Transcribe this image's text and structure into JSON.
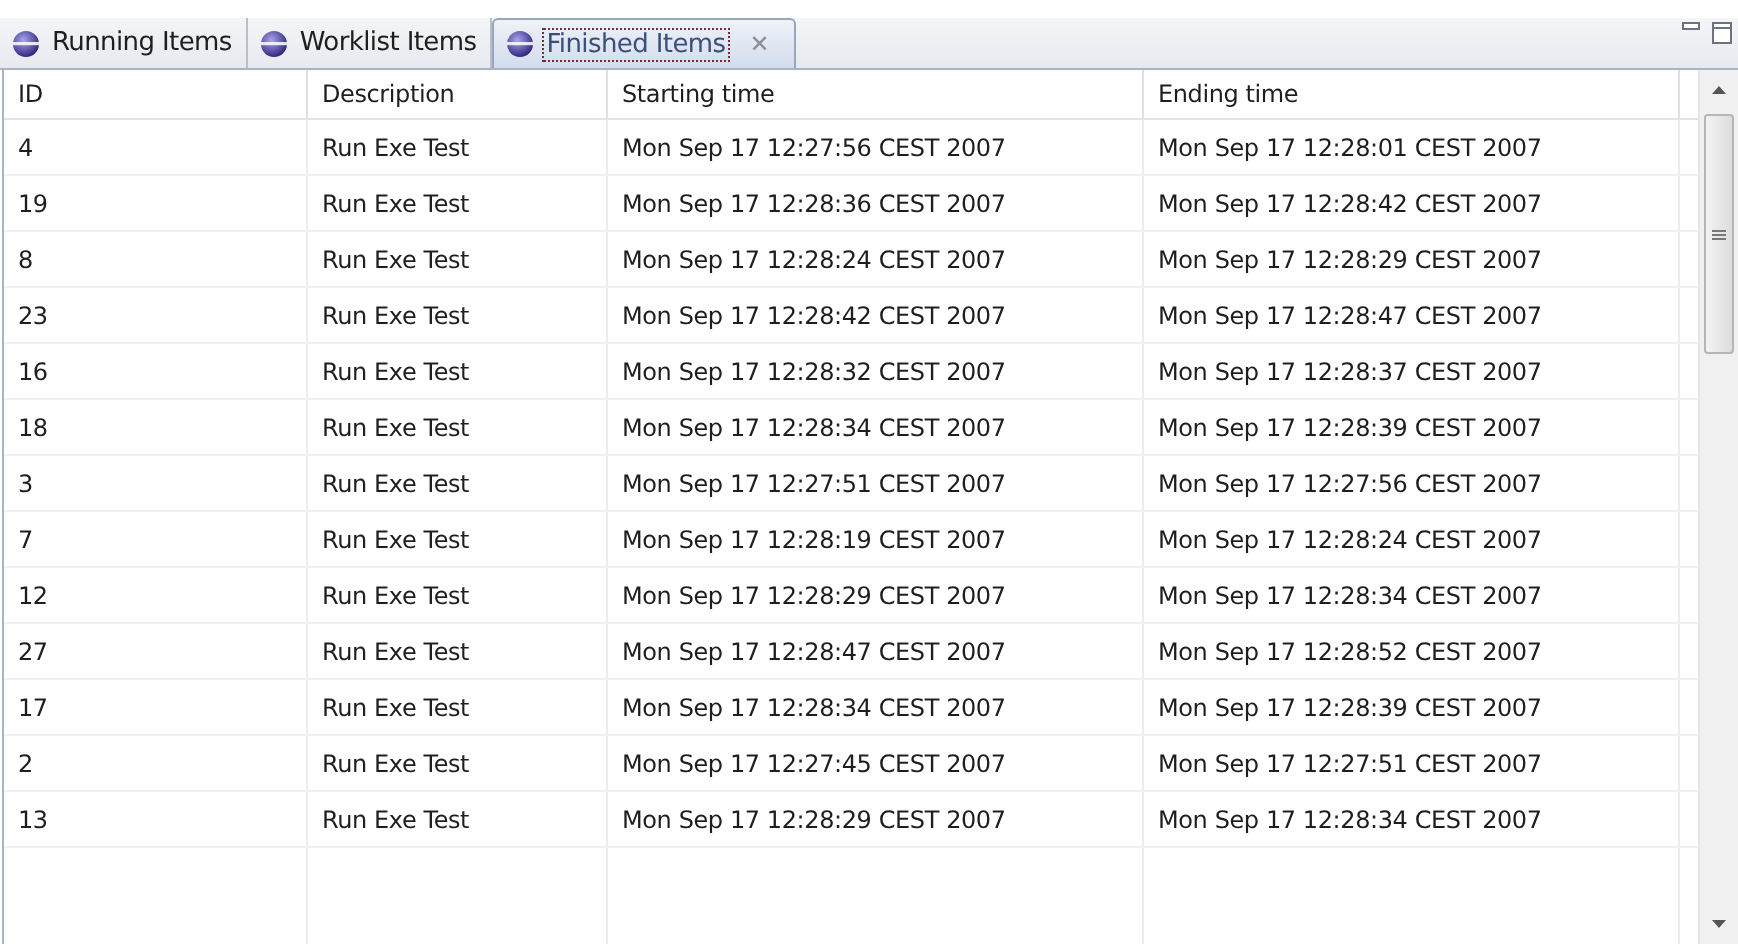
{
  "tabs": [
    {
      "label": "Running Items",
      "selected": false,
      "closable": false
    },
    {
      "label": "Worklist Items",
      "selected": false,
      "closable": false
    },
    {
      "label": "Finished Items",
      "selected": true,
      "closable": true,
      "close_glyph": "✕"
    }
  ],
  "table": {
    "columns": [
      "ID",
      "Description",
      "Starting time",
      "Ending time"
    ],
    "rows": [
      [
        "4",
        "Run Exe Test",
        "Mon Sep 17 12:27:56 CEST 2007",
        "Mon Sep 17 12:28:01 CEST 2007"
      ],
      [
        "19",
        "Run Exe Test",
        "Mon Sep 17 12:28:36 CEST 2007",
        "Mon Sep 17 12:28:42 CEST 2007"
      ],
      [
        "8",
        "Run Exe Test",
        "Mon Sep 17 12:28:24 CEST 2007",
        "Mon Sep 17 12:28:29 CEST 2007"
      ],
      [
        "23",
        "Run Exe Test",
        "Mon Sep 17 12:28:42 CEST 2007",
        "Mon Sep 17 12:28:47 CEST 2007"
      ],
      [
        "16",
        "Run Exe Test",
        "Mon Sep 17 12:28:32 CEST 2007",
        "Mon Sep 17 12:28:37 CEST 2007"
      ],
      [
        "18",
        "Run Exe Test",
        "Mon Sep 17 12:28:34 CEST 2007",
        "Mon Sep 17 12:28:39 CEST 2007"
      ],
      [
        "3",
        "Run Exe Test",
        "Mon Sep 17 12:27:51 CEST 2007",
        "Mon Sep 17 12:27:56 CEST 2007"
      ],
      [
        "7",
        "Run Exe Test",
        "Mon Sep 17 12:28:19 CEST 2007",
        "Mon Sep 17 12:28:24 CEST 2007"
      ],
      [
        "12",
        "Run Exe Test",
        "Mon Sep 17 12:28:29 CEST 2007",
        "Mon Sep 17 12:28:34 CEST 2007"
      ],
      [
        "27",
        "Run Exe Test",
        "Mon Sep 17 12:28:47 CEST 2007",
        "Mon Sep 17 12:28:52 CEST 2007"
      ],
      [
        "17",
        "Run Exe Test",
        "Mon Sep 17 12:28:34 CEST 2007",
        "Mon Sep 17 12:28:39 CEST 2007"
      ],
      [
        "2",
        "Run Exe Test",
        "Mon Sep 17 12:27:45 CEST 2007",
        "Mon Sep 17 12:27:51 CEST 2007"
      ],
      [
        "13",
        "Run Exe Test",
        "Mon Sep 17 12:28:29 CEST 2007",
        "Mon Sep 17 12:28:34 CEST 2007"
      ]
    ]
  }
}
